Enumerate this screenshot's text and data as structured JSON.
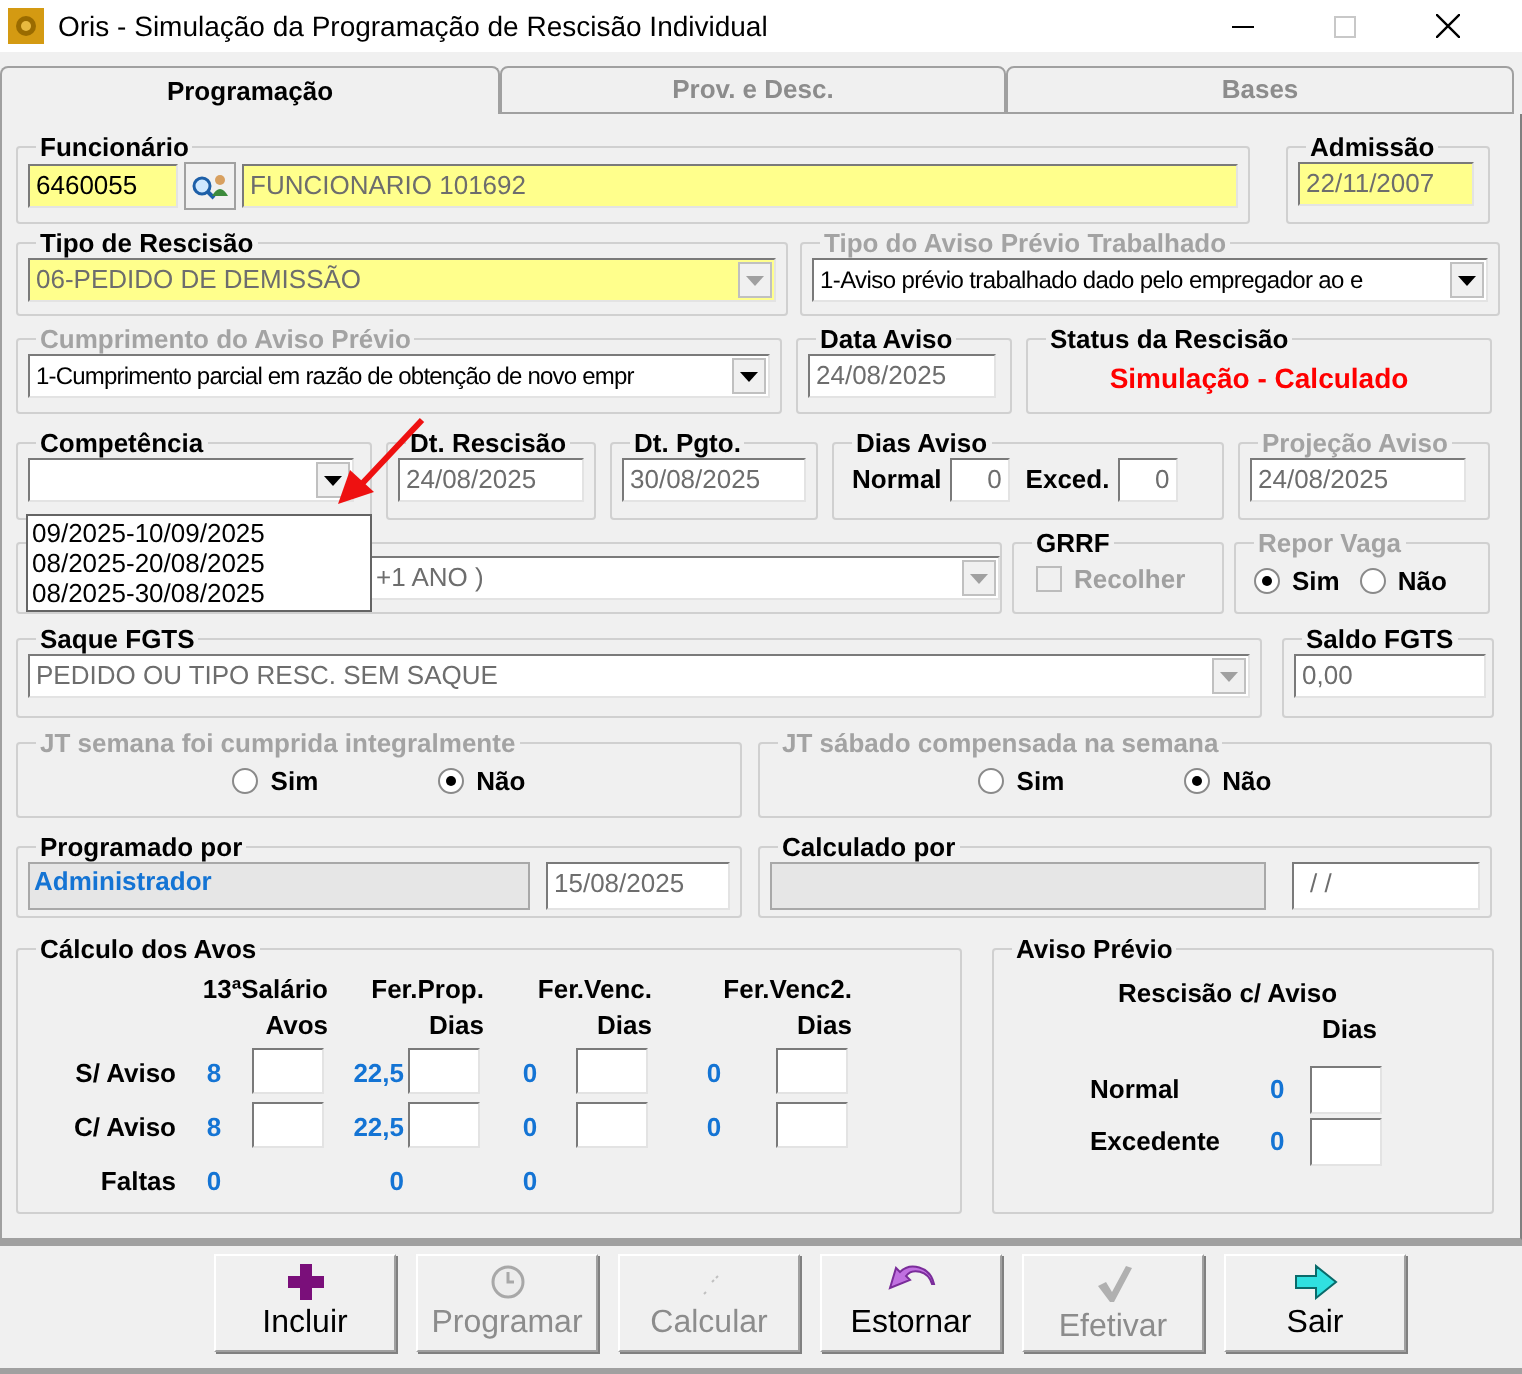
{
  "window": {
    "title": "Oris - Simulação da Programação de Rescisão Individual"
  },
  "tabs": [
    {
      "label": "Programação",
      "selected": true
    },
    {
      "label": "Prov. e Desc.",
      "selected": false
    },
    {
      "label": "Bases",
      "selected": false
    }
  ],
  "funcionario": {
    "label": "Funcionário",
    "disabled": false,
    "code": "6460055",
    "name": "FUNCIONARIO 101692",
    "readonly": true
  },
  "admissao": {
    "label": "Admissão",
    "disabled": false,
    "value": "22/11/2007",
    "readonly": true
  },
  "tipo_rescisao": {
    "label": "Tipo de Rescisão",
    "disabled": false,
    "value": "06-PEDIDO DE DEMISSÃO",
    "readonly": true
  },
  "tipo_aviso": {
    "label": "Tipo do Aviso Prévio Trabalhado",
    "disabled": true,
    "value": "1-Aviso prévio trabalhado dado pelo empregador ao e",
    "readonly": false
  },
  "cumprimento": {
    "label": "Cumprimento do Aviso Prévio",
    "disabled": true,
    "value": "1-Cumprimento parcial em razão de obtenção de novo empr",
    "readonly": false
  },
  "data_aviso": {
    "label": "Data Aviso",
    "disabled": false,
    "value": "24/08/2025",
    "readonly": true
  },
  "status": {
    "label": "Status da Rescisão",
    "disabled": false,
    "value": "Simulação - Calculado"
  },
  "competencia": {
    "label": "Competência",
    "disabled": false,
    "expanded": true,
    "options": [
      "09/2025-10/09/2025",
      "08/2025-20/08/2025",
      "08/2025-30/08/2025"
    ]
  },
  "dt_rescisao": {
    "label": "Dt. Rescisão",
    "disabled": false,
    "value": "24/08/2025",
    "readonly": true
  },
  "dt_pgto": {
    "label": "Dt. Pgto.",
    "disabled": false,
    "value": "30/08/2025",
    "readonly": true
  },
  "dias_aviso": {
    "label": "Dias Aviso",
    "disabled": false,
    "fields": [
      {
        "label": "Normal",
        "value": "0"
      },
      {
        "label": "Exced.",
        "value": "0"
      }
    ]
  },
  "projecao_aviso": {
    "label": "Projeção Aviso",
    "disabled": true,
    "value": "24/08/2025",
    "readonly": true
  },
  "group_5": {
    "value": "+1 ANO )",
    "readonly": true
  },
  "grrf": {
    "label": "GRRF",
    "disabled": false,
    "checkbox": {
      "label": "Recolher",
      "checked": false,
      "disabled": true
    }
  },
  "repor_vaga": {
    "label": "Repor Vaga",
    "disabled": true,
    "options": [
      {
        "label": "Sim",
        "selected": true
      },
      {
        "label": "Não",
        "selected": false
      }
    ]
  },
  "saque_fgts": {
    "label": "Saque FGTS",
    "disabled": false,
    "value": "PEDIDO OU TIPO RESC. SEM SAQUE",
    "readonly": true
  },
  "saldo_fgts": {
    "label": "Saldo FGTS",
    "disabled": false,
    "value": "0,00",
    "readonly": true
  },
  "jt_semana": {
    "label": "JT semana foi cumprida integralmente",
    "disabled": true,
    "options": [
      {
        "label": "Sim",
        "selected": false
      },
      {
        "label": "Não",
        "selected": true
      }
    ]
  },
  "jt_sabado": {
    "label": "JT sábado compensada na semana",
    "disabled": true,
    "options": [
      {
        "label": "Sim",
        "selected": false
      },
      {
        "label": "Não",
        "selected": true
      }
    ]
  },
  "programado_por": {
    "label": "Programado por",
    "disabled": false,
    "user": "Administrador",
    "date": "15/08/2025"
  },
  "calculado_por": {
    "label": "Calculado por",
    "disabled": false,
    "date": "/ /"
  },
  "calculo_avos": {
    "label": "Cálculo dos Avos",
    "disabled": false,
    "columns": [
      {
        "heading": "13ªSalário",
        "unit": "Avos"
      },
      {
        "heading": "Fer.Prop.",
        "unit": "Dias"
      },
      {
        "heading": "Fer.Venc.",
        "unit": "Dias"
      },
      {
        "heading": "Fer.Venc2.",
        "unit": "Dias"
      }
    ],
    "rows": [
      {
        "label": "S/ Aviso",
        "kind": "boxes",
        "values": [
          "8",
          "22,5",
          "0",
          "0"
        ]
      },
      {
        "label": "C/ Aviso",
        "kind": "boxes",
        "values": [
          "8",
          "22,5",
          "0",
          "0"
        ]
      },
      {
        "label": "Faltas",
        "kind": "plain",
        "values": [
          "0",
          "0",
          "0"
        ]
      }
    ]
  },
  "aviso_previo": {
    "label": "Aviso Prévio",
    "disabled": false,
    "heading": "Rescisão c/ Aviso",
    "unit": "Dias",
    "rows": [
      {
        "label": "Normal",
        "value": "0"
      },
      {
        "label": "Excedente",
        "value": "0"
      }
    ]
  },
  "buttons": [
    {
      "label": "Incluir",
      "disabled": false
    },
    {
      "label": "Programar",
      "disabled": true
    },
    {
      "label": "Calcular",
      "disabled": true
    },
    {
      "label": "Estornar",
      "disabled": false
    },
    {
      "label": "Efetivar",
      "disabled": true
    },
    {
      "label": "Sair",
      "disabled": false
    }
  ]
}
